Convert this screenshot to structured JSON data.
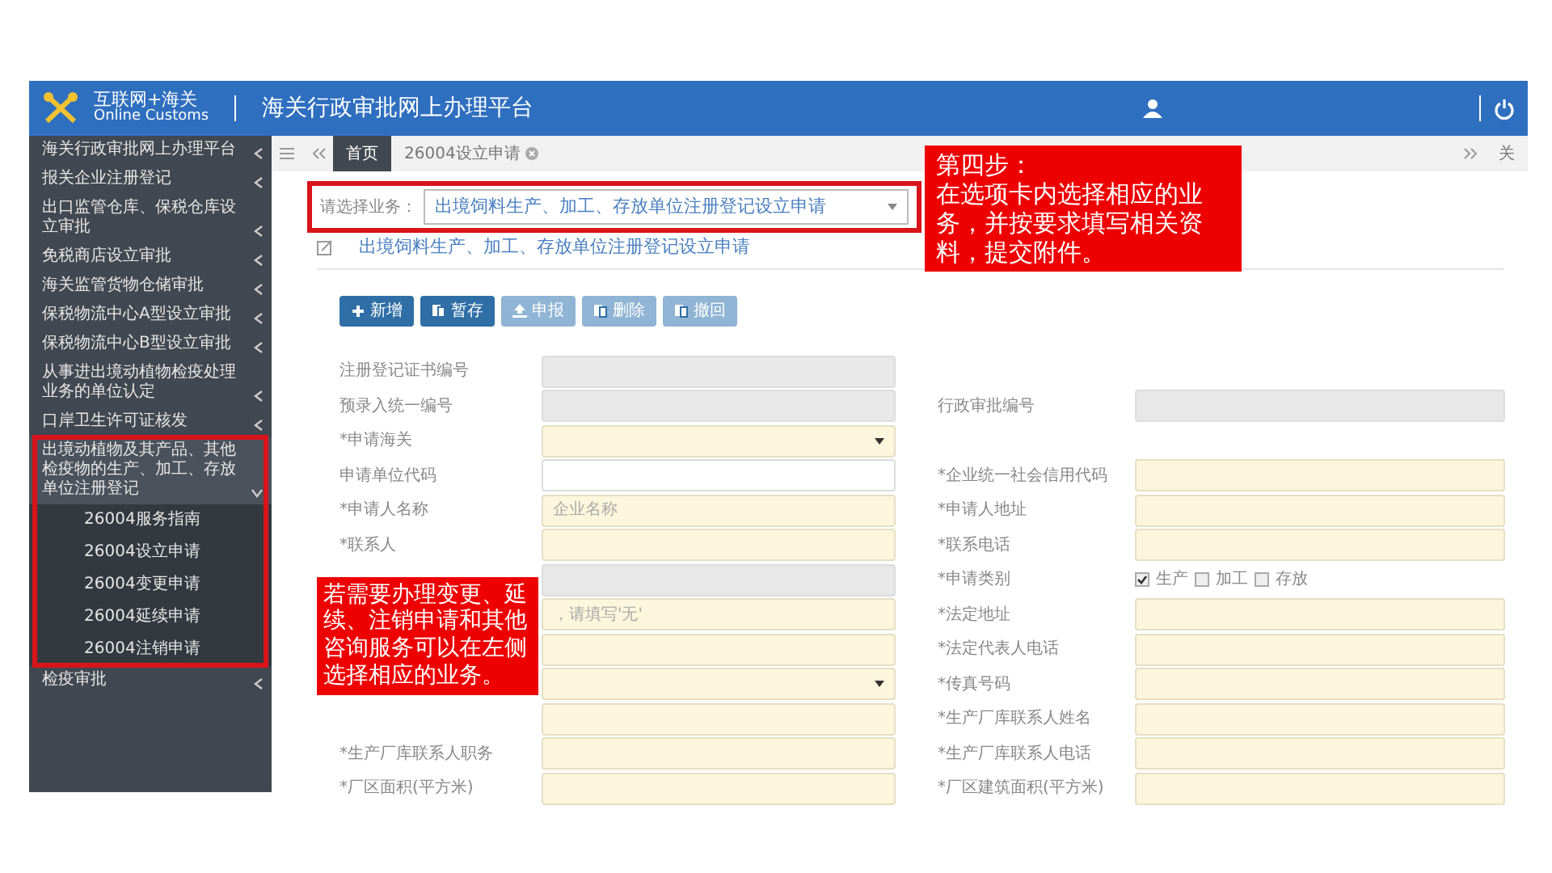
{
  "header": {
    "brand_cn": "互联网+海关",
    "brand_en": "Online Customs",
    "title": "海关行政审批网上办理平台"
  },
  "sidebar": {
    "title": "海关行政审批网上办理平台",
    "items": [
      {
        "label": "报关企业注册登记",
        "expanded": false
      },
      {
        "label": "出口监管仓库、保税仓库设立审批",
        "expanded": false
      },
      {
        "label": "免税商店设立审批",
        "expanded": false
      },
      {
        "label": "海关监管货物仓储审批",
        "expanded": false
      },
      {
        "label": "保税物流中心A型设立审批",
        "expanded": false
      },
      {
        "label": "保税物流中心B型设立审批",
        "expanded": false
      },
      {
        "label": "从事进出境动植物检疫处理业务的单位认定",
        "expanded": false
      },
      {
        "label": "口岸卫生许可证核发",
        "expanded": false
      },
      {
        "label": "出境动植物及其产品、其他检疫物的生产、加工、存放单位注册登记",
        "expanded": true,
        "children": [
          {
            "label": "26004服务指南"
          },
          {
            "label": "26004设立申请"
          },
          {
            "label": "26004变更申请"
          },
          {
            "label": "26004延续申请"
          },
          {
            "label": "26004注销申请"
          }
        ]
      },
      {
        "label": "检疫审批",
        "expanded": false
      }
    ]
  },
  "tabs": [
    {
      "label": "首页",
      "selected": true
    },
    {
      "label": "26004设立申请",
      "selected": false
    }
  ],
  "tab_strip_right": "关",
  "business_select": {
    "label": "请选择业务：",
    "value": "出境饲料生产、加工、存放单位注册登记设立申请"
  },
  "form_title": "出境饲料生产、加工、存放单位注册登记设立申请",
  "buttons": [
    {
      "label": "新增",
      "disabled": false
    },
    {
      "label": "暂存",
      "disabled": false
    },
    {
      "label": "申报",
      "disabled": true
    },
    {
      "label": "删除",
      "disabled": true
    },
    {
      "label": "撤回",
      "disabled": true
    }
  ],
  "rows": [
    {
      "left": {
        "label": "注册登记证书编号",
        "kind": "readonly"
      }
    },
    {
      "left": {
        "label": "预录入统一编号",
        "kind": "readonly"
      },
      "right": {
        "label": "行政审批编号",
        "kind": "readonly"
      }
    },
    {
      "left": {
        "label": "*申请海关",
        "kind": "select",
        "highlighted": true
      }
    },
    {
      "left": {
        "label": "申请单位代码",
        "kind": "input",
        "highlighted": false
      },
      "right": {
        "label": "*企业统一社会信用代码",
        "kind": "input",
        "highlighted": true
      }
    },
    {
      "left": {
        "label": "*申请人名称",
        "kind": "input",
        "highlighted": true,
        "placeholder": "企业名称"
      },
      "right": {
        "label": "*申请人地址",
        "kind": "input",
        "highlighted": true
      }
    },
    {
      "left": {
        "label": "*联系人",
        "kind": "input",
        "highlighted": true
      },
      "right": {
        "label": "*联系电话",
        "kind": "input",
        "highlighted": true
      }
    },
    {
      "left": {
        "kind": "readonly"
      },
      "right": {
        "label": "*申请类别",
        "kind": "checkboxes",
        "options": [
          {
            "label": "生产",
            "checked": true
          },
          {
            "label": "加工",
            "checked": false
          },
          {
            "label": "存放",
            "checked": false
          }
        ]
      }
    },
    {
      "left": {
        "kind": "input",
        "highlighted": true,
        "placeholder": "，请填写'无'"
      },
      "right": {
        "label": "*法定地址",
        "kind": "input",
        "highlighted": true
      }
    },
    {
      "left": {
        "kind": "input",
        "highlighted": true
      },
      "right": {
        "label": "*法定代表人电话",
        "kind": "input",
        "highlighted": true
      }
    },
    {
      "left": {
        "kind": "select",
        "highlighted": true
      },
      "right": {
        "label": "*传真号码",
        "kind": "input",
        "highlighted": true
      }
    },
    {
      "left": {
        "kind": "input",
        "highlighted": true
      },
      "right": {
        "label": "*生产厂库联系人姓名",
        "kind": "input",
        "highlighted": true
      }
    },
    {
      "left": {
        "label": "*生产厂库联系人职务",
        "kind": "input",
        "highlighted": true
      },
      "right": {
        "label": "*生产厂库联系人电话",
        "kind": "input",
        "highlighted": true
      }
    },
    {
      "left": {
        "label": "*厂区面积(平方米)",
        "kind": "input",
        "highlighted": true
      },
      "right": {
        "label": "*厂区建筑面积(平方米)",
        "kind": "input",
        "highlighted": true
      }
    }
  ],
  "annotations": [
    {
      "title": "第四步：",
      "text": "在选项卡内选择相应的业务，并按要求填写相关资料，提交附件。"
    },
    {
      "text": "若需要办理变更、延续、注销申请和其他咨询服务可以在左侧选择相应的业务。"
    }
  ]
}
